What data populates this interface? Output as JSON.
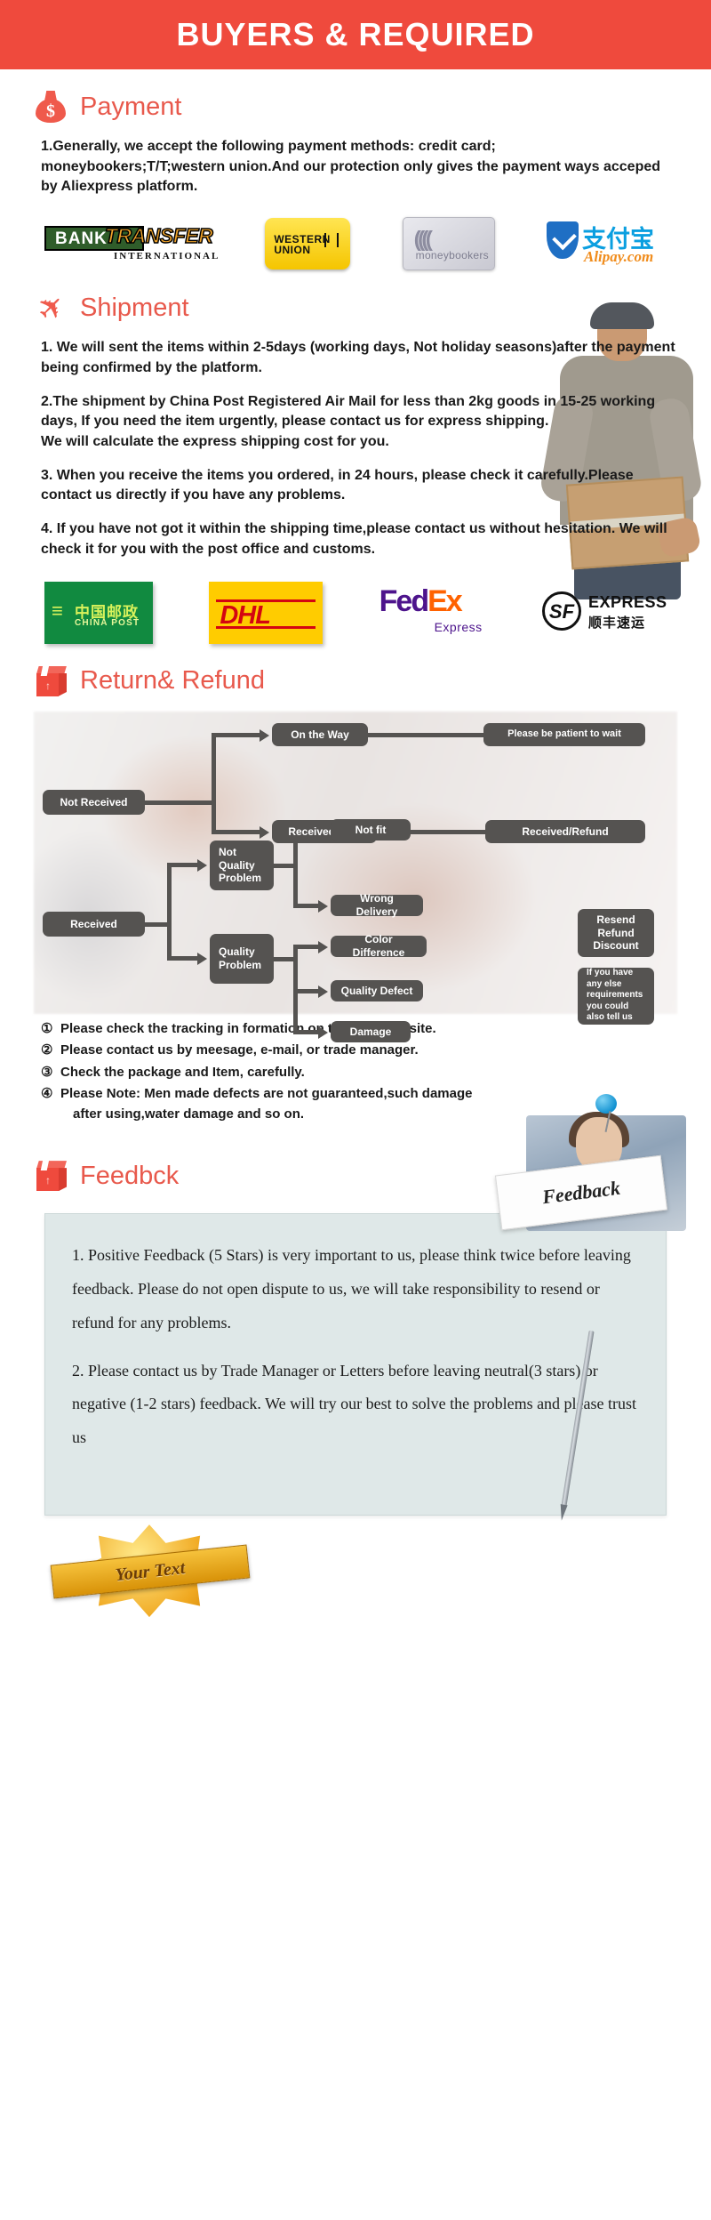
{
  "header": {
    "title": "BUYERS & REQUIRED"
  },
  "payment": {
    "icon": "money-bag-icon",
    "title": "Payment",
    "paragraphs": [
      "1.Generally, we accept the following payment methods: credit card; moneybookers;T/T;western union.And our protection only gives the payment ways acceped by Aliexpress platform."
    ],
    "logos": [
      {
        "name": "bank-transfer-logo",
        "line1": "BANK",
        "line2": "TRANSFER",
        "line3": "INTERNATIONAL"
      },
      {
        "name": "western-union-logo",
        "line1": "WESTERN",
        "line2": "UNION"
      },
      {
        "name": "moneybookers-logo",
        "line1": "moneybookers"
      },
      {
        "name": "alipay-logo",
        "line1": "支付宝",
        "line2": "Alipay.com"
      }
    ]
  },
  "shipment": {
    "icon": "airplane-icon",
    "title": "Shipment",
    "paragraphs": [
      "1. We will sent the items within 2-5days (working days, Not holiday seasons)after the payment being confirmed by the platform.",
      "2.The shipment by China Post Registered Air Mail for less than  2kg goods in 15-25 working days, If  you need the item urgently, please contact us for express shipping.\nWe will calculate the express shipping cost for you.",
      "3. When you receive the items you ordered, in 24 hours, please check it carefully.Please contact us directly if you have any problems.",
      "4. If you have not got it within the shipping time,please contact us without hesitation. We will check it for you with the post office and customs."
    ],
    "carriers": [
      {
        "name": "china-post-logo",
        "cn": "中国邮政",
        "en": "CHINA POST"
      },
      {
        "name": "dhl-logo",
        "text": "DHL"
      },
      {
        "name": "fedex-logo",
        "text1": "Fed",
        "text2": "Ex",
        "sub": "Express"
      },
      {
        "name": "sf-express-logo",
        "circle": "SF",
        "en": "EXPRESS",
        "cn": "顺丰速运"
      }
    ]
  },
  "return": {
    "icon": "return-box-icon",
    "title": "Return& Refund",
    "flow": {
      "not_received": "Not Received",
      "on_the_way": "On the Way",
      "be_patient": "Please be patient to wait",
      "received_lost": "Received/Lost",
      "received_refund": "Received/Refund",
      "received": "Received",
      "not_quality_problem": "Not\nQuality\nProblem",
      "quality_problem": "Quality\nProblem",
      "not_fit": "Not fit",
      "wrong_delivery": "Wrong Delivery",
      "color_difference": "Color Difference",
      "quality_defect": "Quality Defect",
      "damage": "Damage",
      "resend_refund_discount": "Resend\nRefund\nDiscount",
      "else_requirements": "If you have any else requirements you could also tell us"
    },
    "notes": [
      {
        "num": "①",
        "text": "Please check the tracking in formation on tracking website."
      },
      {
        "num": "②",
        "text": "Please contact us by meesage, e-mail, or trade manager."
      },
      {
        "num": "③",
        "text": "Check the package and Item, carefully."
      },
      {
        "num": "④",
        "text": "Please Note: Men made defects  are not guaranteed,such damage",
        "cont": "after using,water damage and so on."
      }
    ]
  },
  "feedback": {
    "icon": "feedback-box-icon",
    "title": "Feedbck",
    "photo_card_text": "Feedback",
    "paragraphs": [
      "1. Positive Feedback (5 Stars) is very important to us, please think twice before leaving feedback. Please do not open dispute to us,   we will take responsibility to resend or refund for any problems.",
      "2. Please contact us by Trade Manager or Letters before leaving neutral(3 stars) or negative (1-2 stars) feedback. We will try our best to solve the problems and please trust us"
    ]
  },
  "badge": {
    "text": "Your Text"
  },
  "colors": {
    "accent": "#ef4a3d",
    "title": "#e8594c",
    "node": "#555351",
    "feedback_bg": "#dfe8e8"
  }
}
